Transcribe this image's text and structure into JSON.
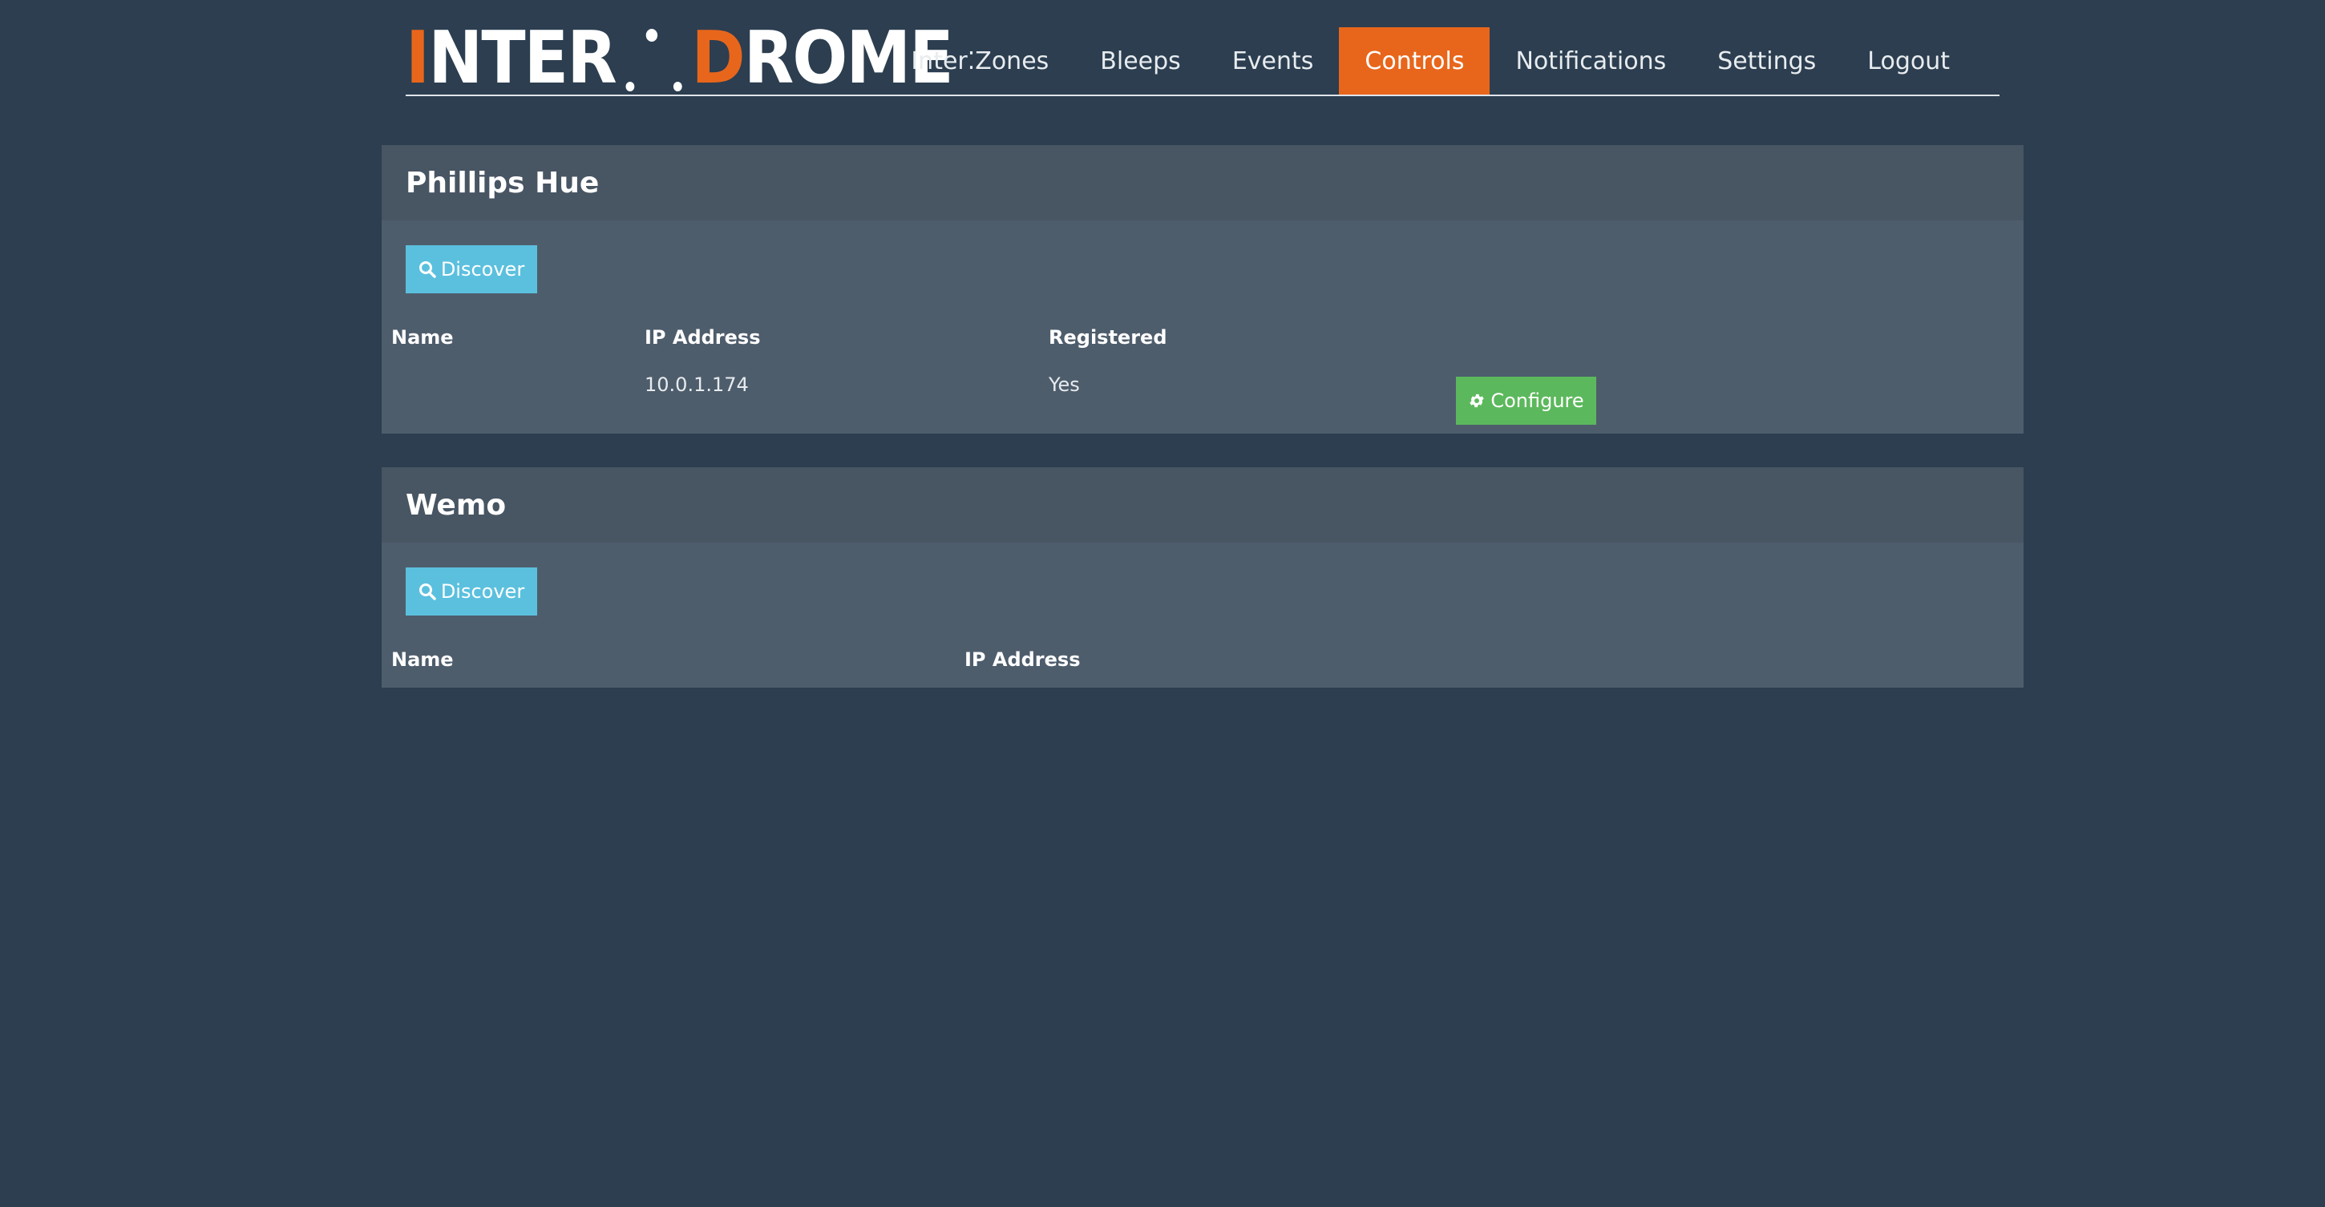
{
  "header": {
    "logo": {
      "part1_accent": "I",
      "part1": "NTER",
      "part2_accent": "D",
      "part2": "ROME"
    },
    "nav": [
      {
        "label": "Inter⁚Zones",
        "active": false
      },
      {
        "label": "Bleeps",
        "active": false
      },
      {
        "label": "Events",
        "active": false
      },
      {
        "label": "Controls",
        "active": true
      },
      {
        "label": "Notifications",
        "active": false
      },
      {
        "label": "Settings",
        "active": false
      },
      {
        "label": "Logout",
        "active": false
      }
    ]
  },
  "panels": {
    "hue": {
      "title": "Phillips Hue",
      "discover_label": "Discover",
      "columns": [
        "Name",
        "IP Address",
        "Registered"
      ],
      "rows": [
        {
          "name": "",
          "ip": "10.0.1.174",
          "registered": "Yes",
          "action_label": "Configure"
        }
      ]
    },
    "wemo": {
      "title": "Wemo",
      "discover_label": "Discover",
      "columns": [
        "Name",
        "IP Address"
      ],
      "rows": []
    }
  },
  "colors": {
    "background": "#2c3e50",
    "panel": "#4e5d6c",
    "panel_heading": "#485563",
    "accent": "#e8661b",
    "info": "#5bc0de",
    "success": "#5cb85c"
  },
  "icons": {
    "discover": "search-icon",
    "configure": "gear-icon"
  }
}
